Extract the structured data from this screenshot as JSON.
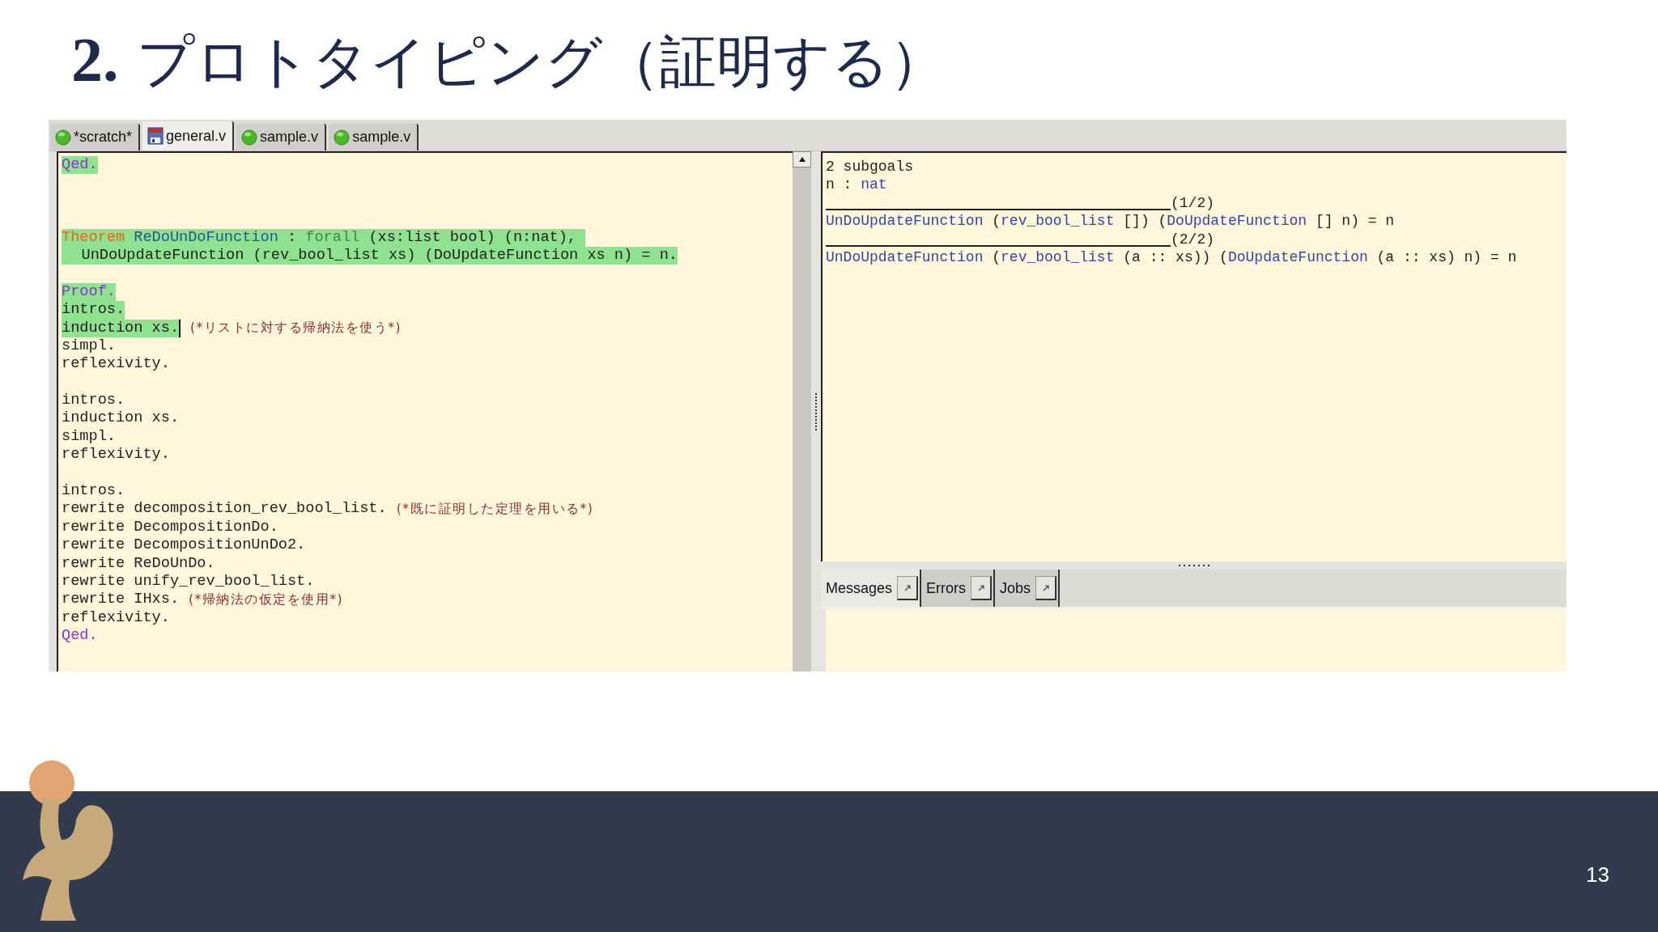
{
  "title": "**2.** プロトタイピング（証明する）",
  "tabs": [
    {
      "label": "*scratch*",
      "kind": "dot",
      "selected": false
    },
    {
      "label": "general.v",
      "kind": "floppy",
      "selected": true
    },
    {
      "label": "sample.v",
      "kind": "dot",
      "selected": false
    },
    {
      "label": "sample.v",
      "kind": "dot",
      "selected": false
    }
  ],
  "editor": {
    "lines": [
      {
        "kind": "code",
        "processed": true,
        "indented": false,
        "cursor": false,
        "segments": [
          {
            "text": "Qed.",
            "kind": "vernacular"
          }
        ]
      },
      {
        "kind": "blank"
      },
      {
        "kind": "blank"
      },
      {
        "kind": "blank"
      },
      {
        "kind": "code",
        "processed": true,
        "indented": false,
        "cursor": false,
        "segments": [
          {
            "text": "Theorem ",
            "kind": "keyword"
          },
          {
            "text": "ReDoUnDoFunction",
            "kind": "ident"
          },
          {
            "text": " : ",
            "kind": "plain"
          },
          {
            "text": "forall",
            "kind": "binder"
          },
          {
            "text": " (xs:list bool) (n:nat), ",
            "kind": "plain"
          }
        ]
      },
      {
        "kind": "code",
        "processed": true,
        "indented": true,
        "cursor": false,
        "segments": [
          {
            "text": "UnDoUpdateFunction (rev_bool_list xs) (DoUpdateFunction xs n) = n.",
            "kind": "plain"
          }
        ]
      },
      {
        "kind": "blank"
      },
      {
        "kind": "code",
        "processed": true,
        "indented": false,
        "cursor": false,
        "segments": [
          {
            "text": "Proof.",
            "kind": "vernacular"
          }
        ]
      },
      {
        "kind": "code",
        "processed": true,
        "indented": false,
        "cursor": false,
        "segments": [
          {
            "text": "intros.",
            "kind": "plain"
          }
        ]
      },
      {
        "kind": "code",
        "processed": true,
        "indented": false,
        "cursor": true,
        "segments": [
          {
            "text": "induction xs.",
            "kind": "plain"
          }
        ],
        "comment": "(*リストに対する帰納法を使う*)"
      },
      {
        "kind": "code",
        "processed": false,
        "indented": false,
        "cursor": false,
        "segments": [
          {
            "text": "simpl.",
            "kind": "plain"
          }
        ]
      },
      {
        "kind": "code",
        "processed": false,
        "indented": false,
        "cursor": false,
        "segments": [
          {
            "text": "reflexivity.",
            "kind": "plain"
          }
        ]
      },
      {
        "kind": "blank"
      },
      {
        "kind": "code",
        "processed": false,
        "indented": false,
        "cursor": false,
        "segments": [
          {
            "text": "intros.",
            "kind": "plain"
          }
        ]
      },
      {
        "kind": "code",
        "processed": false,
        "indented": false,
        "cursor": false,
        "segments": [
          {
            "text": "induction xs.",
            "kind": "plain"
          }
        ]
      },
      {
        "kind": "code",
        "processed": false,
        "indented": false,
        "cursor": false,
        "segments": [
          {
            "text": "simpl.",
            "kind": "plain"
          }
        ]
      },
      {
        "kind": "code",
        "processed": false,
        "indented": false,
        "cursor": false,
        "segments": [
          {
            "text": "reflexivity.",
            "kind": "plain"
          }
        ]
      },
      {
        "kind": "blank"
      },
      {
        "kind": "code",
        "processed": false,
        "indented": false,
        "cursor": false,
        "segments": [
          {
            "text": "intros.",
            "kind": "plain"
          }
        ]
      },
      {
        "kind": "code",
        "processed": false,
        "indented": false,
        "cursor": false,
        "segments": [
          {
            "text": "rewrite decomposition_rev_bool_list.",
            "kind": "plain"
          }
        ],
        "comment": "(*既に証明した定理を用いる*)"
      },
      {
        "kind": "code",
        "processed": false,
        "indented": false,
        "cursor": false,
        "segments": [
          {
            "text": "rewrite DecompositionDo.",
            "kind": "plain"
          }
        ]
      },
      {
        "kind": "code",
        "processed": false,
        "indented": false,
        "cursor": false,
        "segments": [
          {
            "text": "rewrite DecompositionUnDo2.",
            "kind": "plain"
          }
        ]
      },
      {
        "kind": "code",
        "processed": false,
        "indented": false,
        "cursor": false,
        "segments": [
          {
            "text": "rewrite ReDoUnDo.",
            "kind": "plain"
          }
        ]
      },
      {
        "kind": "code",
        "processed": false,
        "indented": false,
        "cursor": false,
        "segments": [
          {
            "text": "rewrite unify_rev_bool_list.",
            "kind": "plain"
          }
        ]
      },
      {
        "kind": "code",
        "processed": false,
        "indented": false,
        "cursor": false,
        "segments": [
          {
            "text": "rewrite IHxs.",
            "kind": "plain"
          }
        ],
        "comment": "(*帰納法の仮定を使用*)"
      },
      {
        "kind": "code",
        "processed": false,
        "indented": false,
        "cursor": false,
        "segments": [
          {
            "text": "reflexivity.",
            "kind": "plain"
          }
        ]
      },
      {
        "kind": "code",
        "processed": false,
        "indented": false,
        "cursor": false,
        "segments": [
          {
            "text": "Qed.",
            "kind": "vernacular"
          }
        ]
      }
    ]
  },
  "goals": {
    "lines": [
      {
        "kind": "text",
        "segments": [
          {
            "text": "2 subgoals",
            "kind": "plain"
          }
        ]
      },
      {
        "kind": "text",
        "segments": [
          {
            "text": "n : ",
            "kind": "plain"
          },
          {
            "text": "nat",
            "kind": "ident"
          }
        ]
      },
      {
        "kind": "separator",
        "label": "(1/2)"
      },
      {
        "kind": "text",
        "segments": [
          {
            "text": "UnDoUpdateFunction",
            "kind": "ident"
          },
          {
            "text": " (",
            "kind": "plain"
          },
          {
            "text": "rev_bool_list",
            "kind": "ident"
          },
          {
            "text": " []) (",
            "kind": "plain"
          },
          {
            "text": "DoUpdateFunction",
            "kind": "ident"
          },
          {
            "text": " [] n) = n",
            "kind": "plain"
          }
        ]
      },
      {
        "kind": "separator",
        "label": "(2/2)"
      },
      {
        "kind": "text",
        "segments": [
          {
            "text": "UnDoUpdateFunction",
            "kind": "ident"
          },
          {
            "text": " (",
            "kind": "plain"
          },
          {
            "text": "rev_bool_list",
            "kind": "ident"
          },
          {
            "text": " (a :: xs)) (",
            "kind": "plain"
          },
          {
            "text": "DoUpdateFunction",
            "kind": "ident"
          },
          {
            "text": " (a :: xs) n) = n",
            "kind": "plain"
          }
        ]
      }
    ]
  },
  "message_tabs": [
    {
      "label": "Messages",
      "selected": true
    },
    {
      "label": "Errors",
      "selected": false
    },
    {
      "label": "Jobs",
      "selected": false
    }
  ],
  "footer": {
    "page_number": "13"
  }
}
